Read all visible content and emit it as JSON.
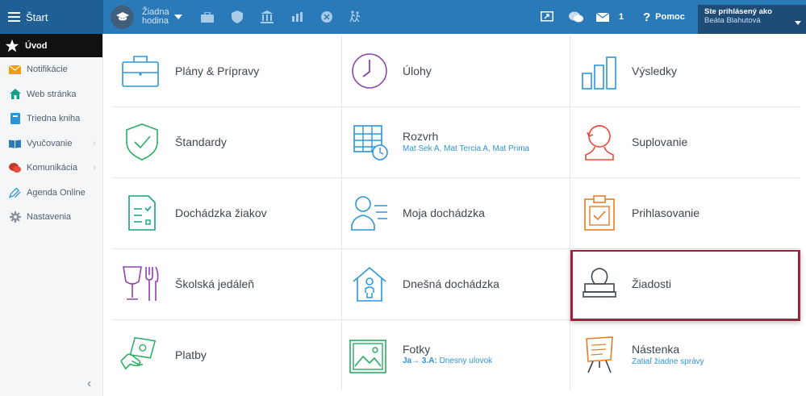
{
  "topbar": {
    "start_label": "Štart",
    "hodina_line1": "Žiadna",
    "hodina_line2": "hodina",
    "messages_count": "1",
    "help_label": "Pomoc",
    "account_line1": "Ste prihlásený ako",
    "account_line2": "Beáta Blahutová"
  },
  "sidebar": {
    "items": [
      {
        "label": "Úvod",
        "icon": "star-icon"
      },
      {
        "label": "Notifikácie",
        "icon": "envelope-icon"
      },
      {
        "label": "Web stránka",
        "icon": "home-icon"
      },
      {
        "label": "Triedna kniha",
        "icon": "book-icon"
      },
      {
        "label": "Vyučovanie",
        "icon": "open-book-icon"
      },
      {
        "label": "Komunikácia",
        "icon": "chat-icon"
      },
      {
        "label": "Agenda Online",
        "icon": "pencil-icon"
      },
      {
        "label": "Nastavenia",
        "icon": "gear-icon"
      }
    ]
  },
  "tiles": {
    "plany": {
      "label": "Plány & Prípravy"
    },
    "ulohy": {
      "label": "Úlohy"
    },
    "vysledky": {
      "label": "Výsledky"
    },
    "standardy": {
      "label": "Štandardy"
    },
    "rozvrh": {
      "label": "Rozvrh",
      "sub": "Mat Sek A, Mat Tercia A, Mat Prima"
    },
    "suplovanie": {
      "label": "Suplovanie"
    },
    "dochadzka_ziakov": {
      "label": "Dochádzka žiakov"
    },
    "moja_dochadzka": {
      "label": "Moja dochádzka"
    },
    "prihlasovanie": {
      "label": "Prihlasovanie"
    },
    "jedalen": {
      "label": "Školská jedáleň"
    },
    "dnesna": {
      "label": "Dnešná dochádzka"
    },
    "ziadosti": {
      "label": "Žiadosti"
    },
    "platby": {
      "label": "Platby"
    },
    "fotky": {
      "label": "Fotky",
      "sub_bold": "Ja→ 3.A:",
      "sub": "Dnesny ulovok"
    },
    "nastenka": {
      "label": "Nástenka",
      "sub": "Zatiaľ žiadne správy"
    }
  },
  "colors": {
    "topbar": "#2a79b8",
    "blue": "#2d95d7",
    "purple": "#8e44ad",
    "green": "#27ae60",
    "red": "#e74c3c",
    "orange": "#e67e22",
    "highlight": "#a81d3a"
  }
}
